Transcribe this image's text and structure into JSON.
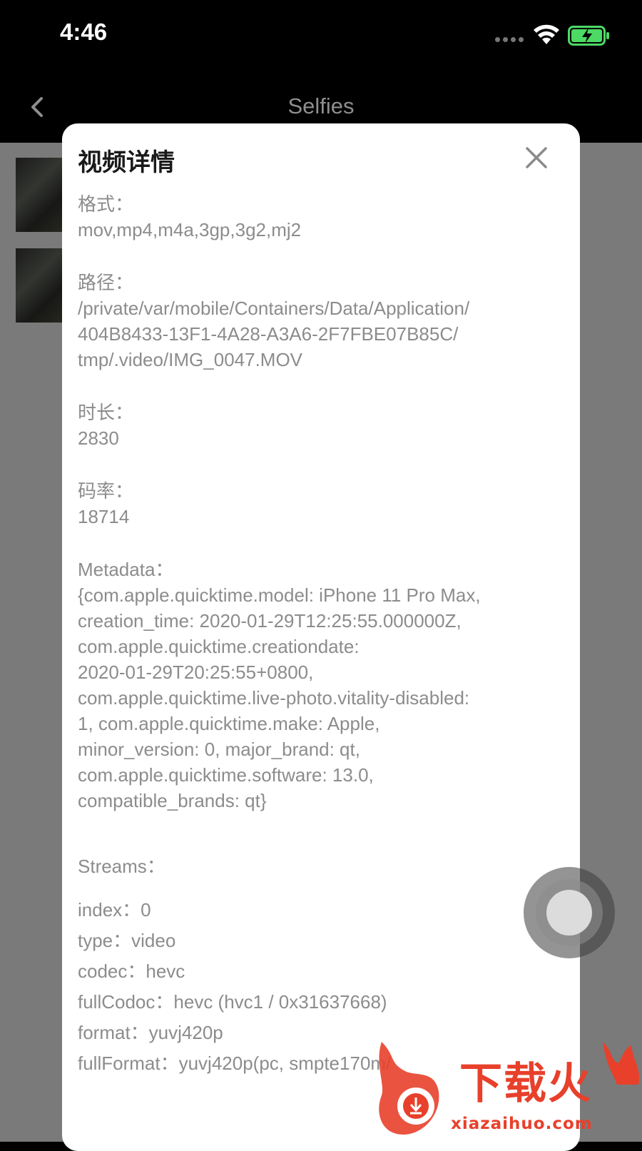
{
  "status_bar": {
    "time": "4:46",
    "wifi_icon": "wifi-icon",
    "battery_icon": "battery-charging-icon",
    "accent": "#4cd964"
  },
  "nav": {
    "title": "Selfies",
    "back_icon": "chevron-left-icon"
  },
  "modal": {
    "title": "视频详情",
    "close_icon": "close-icon",
    "fields": [
      {
        "label": "格式：",
        "value": "mov,mp4,m4a,3gp,3g2,mj2"
      },
      {
        "label": "路径：",
        "value": "/private/var/mobile/Containers/Data/Application/\n404B8433-13F1-4A28-A3A6-2F7FBE07B85C/\ntmp/.video/IMG_0047.MOV"
      },
      {
        "label": "时长：",
        "value": "2830"
      },
      {
        "label": "码率：",
        "value": "18714"
      },
      {
        "label": "Metadata：",
        "value": "{com.apple.quicktime.model: iPhone 11 Pro Max,\ncreation_time: 2020-01-29T12:25:55.000000Z,\ncom.apple.quicktime.creationdate:\n2020-01-29T20:25:55+0800,\ncom.apple.quicktime.live-photo.vitality-disabled:\n1, com.apple.quicktime.make: Apple,\nminor_version: 0, major_brand: qt,\ncom.apple.quicktime.software: 13.0,\ncompatible_brands: qt}"
      }
    ],
    "streams_label": "Streams：",
    "streams": [
      "index：0",
      "type：video",
      "codec：hevc",
      "fullCodoc：hevc (hvc1 / 0x31637668)",
      "format：yuvj420p",
      "fullFormat：yuvj420p(pc, smpte170m/"
    ]
  },
  "watermark": {
    "text": "下载火",
    "domain": "xiazaihuo.com",
    "color": "#e8402b"
  }
}
